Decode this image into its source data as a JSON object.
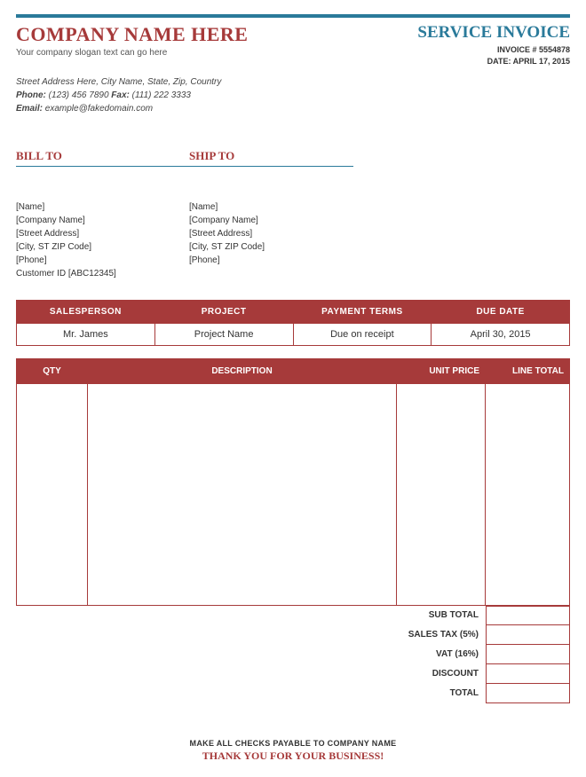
{
  "company": {
    "name": "COMPANY NAME HERE",
    "slogan": "Your company slogan text can go here",
    "address": "Street Address Here, City Name, State, Zip, Country",
    "phone_label": "Phone:",
    "phone": "(123) 456 7890",
    "fax_label": "Fax:",
    "fax": "(111) 222 3333",
    "email_label": "Email:",
    "email": "example@fakedomain.com"
  },
  "invoice": {
    "title": "SERVICE INVOICE",
    "number_label": "INVOICE # ",
    "number": "5554878",
    "date_label": "DATE: ",
    "date": "APRIL 17, 2015"
  },
  "bill_to": {
    "heading": "BILL TO",
    "name": "[Name]",
    "company": "[Company Name]",
    "street": "[Street Address]",
    "city": "[City, ST  ZIP Code]",
    "phone": "[Phone]",
    "customer_id": "Customer ID [ABC12345]"
  },
  "ship_to": {
    "heading": "SHIP TO",
    "name": "[Name]",
    "company": "[Company Name]",
    "street": "[Street Address]",
    "city": "[City, ST  ZIP Code]",
    "phone": "[Phone]"
  },
  "meta": {
    "headers": {
      "salesperson": "SALESPERSON",
      "project": "PROJECT",
      "terms": "PAYMENT TERMS",
      "due": "DUE DATE"
    },
    "values": {
      "salesperson": "Mr. James",
      "project": "Project Name",
      "terms": "Due on receipt",
      "due": "April 30, 2015"
    }
  },
  "items": {
    "headers": {
      "qty": "QTY",
      "desc": "DESCRIPTION",
      "uprice": "UNIT PRICE",
      "ltotal": "LINE TOTAL"
    }
  },
  "totals": {
    "subtotal": "SUB TOTAL",
    "salestax": "SALES TAX (5%)",
    "vat": "VAT (16%)",
    "discount": "DISCOUNT",
    "total": "TOTAL"
  },
  "footer": {
    "line1": "MAKE ALL CHECKS PAYABLE TO COMPANY NAME",
    "line2": "THANK YOU FOR YOUR BUSINESS!"
  }
}
